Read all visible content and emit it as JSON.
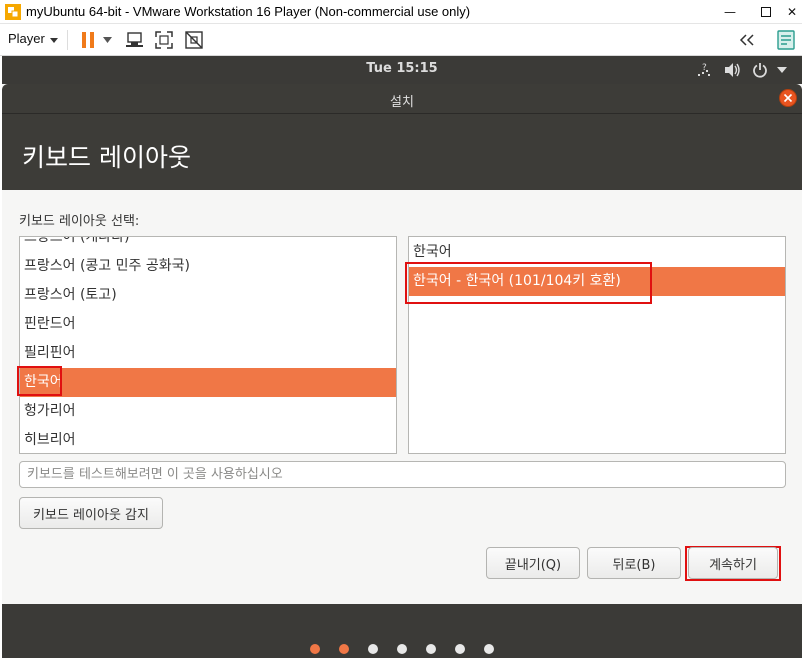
{
  "window": {
    "title": "myUbuntu 64-bit - VMware Workstation 16 Player (Non-commercial use only)",
    "minimize_icon": "minimize-icon",
    "maximize_icon": "maximize-icon",
    "close_icon": "close-icon"
  },
  "toolbar": {
    "player_label": "Player",
    "icons": [
      "pause-icon",
      "send-ctrl-alt-del-icon",
      "fullscreen-icon",
      "unity-icon",
      "back-arrows-icon",
      "library-icon"
    ]
  },
  "panel": {
    "clock": "Tue 15:15",
    "icons": [
      "network-icon",
      "volume-icon",
      "power-icon",
      "menu-caret-icon"
    ]
  },
  "installer": {
    "title": "설치",
    "header_title": "키보드 레이아웃",
    "section_label": "키보드 레이아웃 선택:",
    "layouts": [
      "프랑스어 (캐나다)",
      "프랑스어 (콩고 민주 공화국)",
      "프랑스어 (토고)",
      "핀란드어",
      "필리핀어",
      "한국어",
      "헝가리어",
      "히브리어"
    ],
    "selected_layout": "한국어",
    "variants": [
      "한국어",
      "한국어 - 한국어 (101/104키 호환)"
    ],
    "selected_variant": "한국어 - 한국어 (101/104키 호환)",
    "test_input": {
      "placeholder": "키보드를 테스트해보려면 이 곳을 사용하십시오",
      "value": ""
    },
    "detect_button": "키보드 레이아웃 감지",
    "quit_button": "끝내기(Q)",
    "back_button": "뒤로(B)",
    "continue_button": "계속하기"
  },
  "progress": {
    "total_steps": 7,
    "completed_steps": 2
  },
  "colors": {
    "accent": "#f07746",
    "highlight_annotation": "#e01010",
    "dark_panel": "#3b3a37",
    "dot_active": "#f07746",
    "dot_inactive": "#e8e8e8"
  }
}
